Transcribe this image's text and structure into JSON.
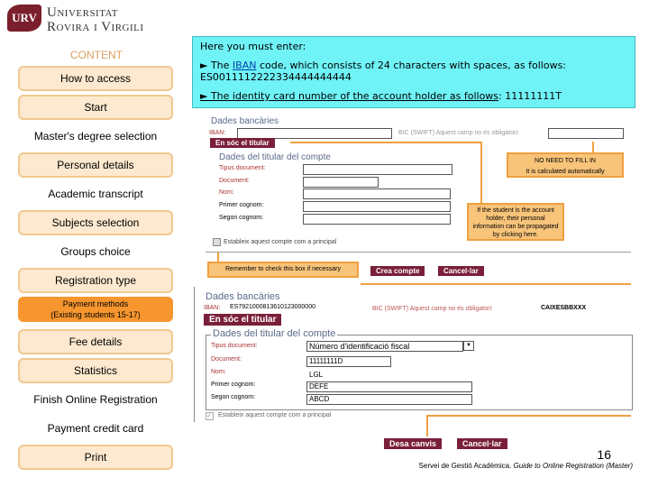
{
  "logo": {
    "line1": "Universitat",
    "line2": "Rovira i Virgili",
    "mark": "URV"
  },
  "sidebar": {
    "heading": "CONTENT",
    "items": [
      {
        "label": "How to access"
      },
      {
        "label": "Start"
      },
      {
        "label": "Master's degree selection"
      },
      {
        "label": "Personal details"
      },
      {
        "label": "Academic transcript"
      },
      {
        "label": "Subjects selection"
      },
      {
        "label": "Groups choice"
      },
      {
        "label": "Registration type"
      },
      {
        "label": "Payment methods (Existing students 15-17)"
      },
      {
        "label": "Fee details"
      },
      {
        "label": "Statistics"
      },
      {
        "label": "Finish Online Registration"
      },
      {
        "label": "Payment credit card"
      },
      {
        "label": "Print"
      }
    ]
  },
  "info": {
    "intro": "Here you must enter:",
    "iban_pre": "► The ",
    "iban_link": "IBAN",
    "iban_post": " code, which consists of 24 characters with spaces, as follows:",
    "iban_example": "ES0011112222334444444444",
    "id_line": "► The identity card number of the account holder as follows",
    "id_example": ": 11111111T"
  },
  "form1": {
    "section": "Dades bancàries",
    "iban_label": "IBAN:",
    "bic_label": "BIC (SWIFT) Aquest camp no és obligatori:",
    "holder_button": "En sóc el titular",
    "holder_section": "Dades del titular del compte",
    "fields": [
      "Tipus document:",
      "Document:",
      "Nom:",
      "Primer cognom:",
      "Segon cognom:"
    ],
    "checkbox": "Estableix aquest compte com a principal",
    "create": "Crea compte",
    "cancel": "Cancel·lar"
  },
  "notes": {
    "bic": [
      "NO NEED TO FILL IN",
      "It is calculated automatically"
    ],
    "holder": "If the student is the account holder, their personal information can be propagated by clicking here.",
    "checkbox": "Remember to check this box if necessary"
  },
  "form2": {
    "section": "Dades bancàries",
    "iban_label": "IBAN:",
    "iban_value": "ES7921000813610123000000",
    "bic_label": "BIC (SWIFT) Aquest camp no és obligatori:",
    "bic_value": "CAIXESBBXXX",
    "holder_button": "En sóc el titular",
    "holder_section": "Dades del titular del compte",
    "fields": [
      "Tipus document:",
      "Document:",
      "Nom:",
      "Primer cognom:",
      "Segon cognom:"
    ],
    "values": [
      "Número d'identificació fiscal",
      "11111111D",
      "LGL",
      "DEFE",
      "ABCD"
    ],
    "checkbox": "Estableix aquest compte com a principal",
    "save": "Desa canvis",
    "cancel": "Cancel·lar"
  },
  "footer": {
    "page": "16",
    "source": "Servei de Gestió Acadèmica. ",
    "guide": "Guide to Online Registration (Master)"
  },
  "colors": {
    "accent": "#f7962e",
    "button": "#7a1f3a",
    "info_bg": "#6ff3f7"
  }
}
